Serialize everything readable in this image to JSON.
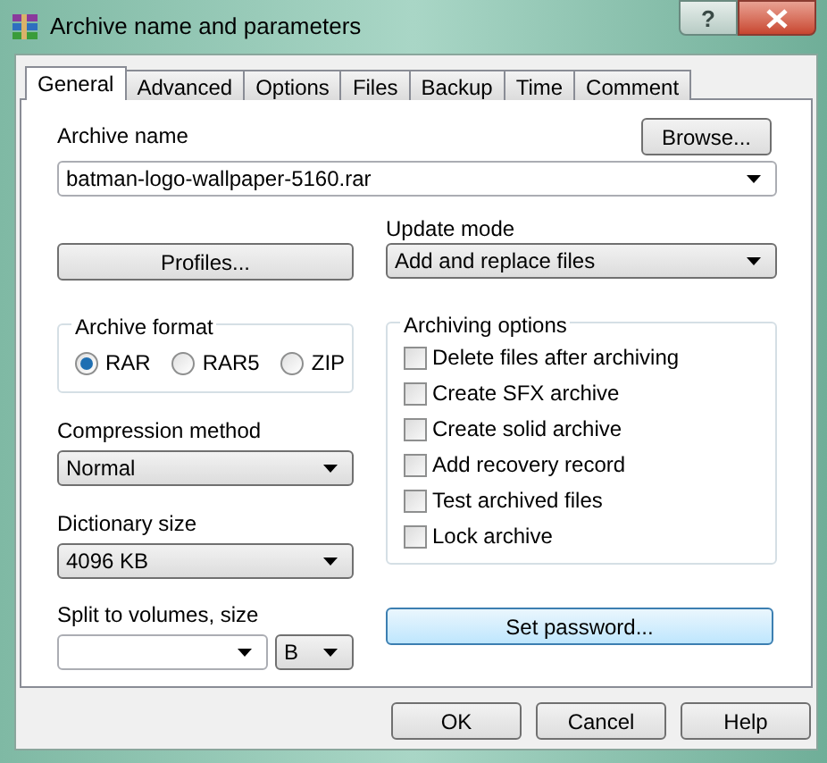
{
  "window": {
    "title": "Archive name and parameters",
    "help_label": "?"
  },
  "tabs": [
    {
      "label": "General",
      "selected": true
    },
    {
      "label": "Advanced",
      "selected": false
    },
    {
      "label": "Options",
      "selected": false
    },
    {
      "label": "Files",
      "selected": false
    },
    {
      "label": "Backup",
      "selected": false
    },
    {
      "label": "Time",
      "selected": false
    },
    {
      "label": "Comment",
      "selected": false
    }
  ],
  "archive_name": {
    "label": "Archive name",
    "value": "batman-logo-wallpaper-5160.rar",
    "browse_button": "Browse..."
  },
  "profiles_button": "Profiles...",
  "update_mode": {
    "label": "Update mode",
    "value": "Add and replace files"
  },
  "archive_format": {
    "title": "Archive format",
    "options": [
      {
        "label": "RAR",
        "selected": true
      },
      {
        "label": "RAR5",
        "selected": false
      },
      {
        "label": "ZIP",
        "selected": false
      }
    ]
  },
  "archiving_options": {
    "title": "Archiving options",
    "options": [
      {
        "label": "Delete files after archiving",
        "checked": false
      },
      {
        "label": "Create SFX archive",
        "checked": false
      },
      {
        "label": "Create solid archive",
        "checked": false
      },
      {
        "label": "Add recovery record",
        "checked": false
      },
      {
        "label": "Test archived files",
        "checked": false
      },
      {
        "label": "Lock archive",
        "checked": false
      }
    ]
  },
  "compression_method": {
    "label": "Compression method",
    "value": "Normal"
  },
  "dictionary_size": {
    "label": "Dictionary size",
    "value": "4096 KB"
  },
  "split_volumes": {
    "label": "Split to volumes, size",
    "unit": "B"
  },
  "set_password_button": "Set password...",
  "buttons": [
    "OK",
    "Cancel",
    "Help"
  ]
}
